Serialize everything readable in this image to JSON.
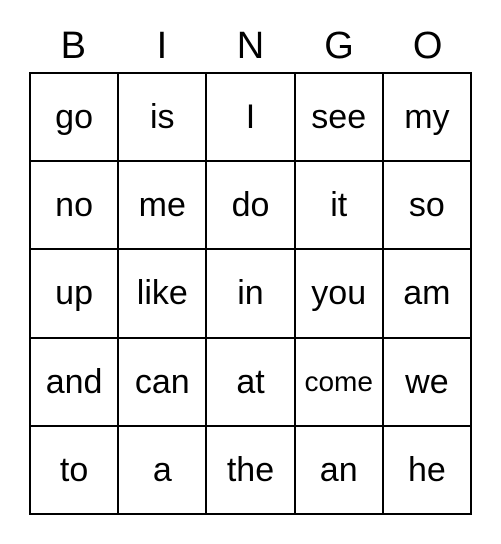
{
  "card": {
    "title": "BINGO",
    "headers": [
      "B",
      "I",
      "N",
      "G",
      "O"
    ],
    "colors": {
      "background": "#ffffff",
      "text": "#000000",
      "grid_line": "#000000"
    },
    "rows": [
      {
        "cells": [
          {
            "label": "go",
            "shrink": false
          },
          {
            "label": "is",
            "shrink": false
          },
          {
            "label": "I",
            "shrink": false
          },
          {
            "label": "see",
            "shrink": false
          },
          {
            "label": "my",
            "shrink": false
          }
        ]
      },
      {
        "cells": [
          {
            "label": "no",
            "shrink": false
          },
          {
            "label": "me",
            "shrink": false
          },
          {
            "label": "do",
            "shrink": false
          },
          {
            "label": "it",
            "shrink": false
          },
          {
            "label": "so",
            "shrink": false
          }
        ]
      },
      {
        "cells": [
          {
            "label": "up",
            "shrink": false
          },
          {
            "label": "like",
            "shrink": false
          },
          {
            "label": "in",
            "shrink": false
          },
          {
            "label": "you",
            "shrink": false
          },
          {
            "label": "am",
            "shrink": false
          }
        ]
      },
      {
        "cells": [
          {
            "label": "and",
            "shrink": false
          },
          {
            "label": "can",
            "shrink": false
          },
          {
            "label": "at",
            "shrink": false
          },
          {
            "label": "come",
            "shrink": true
          },
          {
            "label": "we",
            "shrink": false
          }
        ]
      },
      {
        "cells": [
          {
            "label": "to",
            "shrink": false
          },
          {
            "label": "a",
            "shrink": false
          },
          {
            "label": "the",
            "shrink": false
          },
          {
            "label": "an",
            "shrink": false
          },
          {
            "label": "he",
            "shrink": false
          }
        ]
      }
    ]
  }
}
